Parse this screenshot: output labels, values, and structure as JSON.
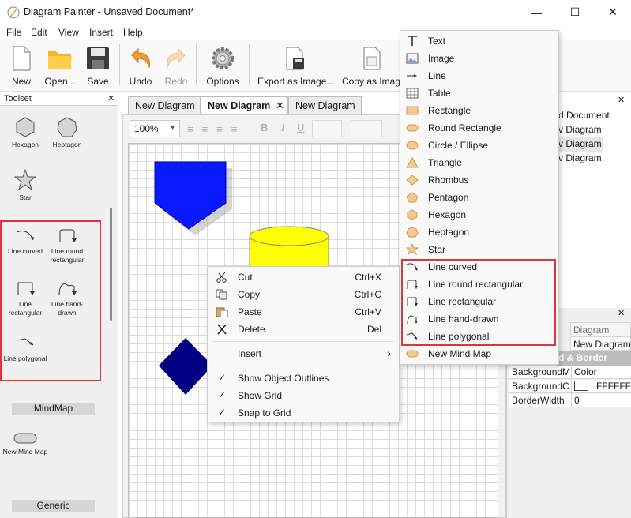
{
  "window": {
    "title": "Diagram Painter - Unsaved Document*",
    "minimize": "—",
    "maximize": "☐",
    "close": "✕"
  },
  "menu": [
    "File",
    "Edit",
    "View",
    "Insert",
    "Help"
  ],
  "toolbar": [
    {
      "label": "New",
      "icon": "new-document-icon"
    },
    {
      "label": "Open...",
      "icon": "open-folder-icon"
    },
    {
      "label": "Save",
      "icon": "save-disk-icon"
    },
    {
      "label": "Undo",
      "icon": "undo-arrow-icon"
    },
    {
      "label": "Redo",
      "icon": "redo-arrow-icon"
    },
    {
      "label": "Options",
      "icon": "gear-icon"
    },
    {
      "label": "Export as Image...",
      "icon": "export-image-icon"
    },
    {
      "label": "Copy as Imag",
      "icon": "copy-image-icon"
    }
  ],
  "toolset": {
    "title": "Toolset",
    "close": "✕",
    "items": [
      {
        "label": "Hexagon"
      },
      {
        "label": "Heptagon"
      },
      {
        "label": "Star"
      },
      {
        "label": "Line curved"
      },
      {
        "label": "Line round rectangular"
      },
      {
        "label": "Line rectangular"
      },
      {
        "label": "Line hand-drawn"
      },
      {
        "label": "Line polygonal"
      },
      {
        "label": "New Mind Map"
      }
    ],
    "sections": [
      "MindMap",
      "Generic"
    ]
  },
  "tabs": [
    {
      "label": "New Diagram",
      "active": false
    },
    {
      "label": "New Diagram",
      "active": true,
      "close": "✕"
    },
    {
      "label": "New Diagram",
      "active": false
    }
  ],
  "format_bar": {
    "zoom": "100%",
    "bold": "B",
    "italic": "I",
    "underline": "U"
  },
  "right_panel": {
    "tree": [
      "d Document",
      "v Diagram",
      "v Diagram",
      "v Diagram"
    ],
    "properties": {
      "header_value": "Diagram",
      "row_name_value": "New Diagram",
      "section": "d & Border",
      "rows": [
        {
          "name": "BackgroundM",
          "value": "Color"
        },
        {
          "name": "BackgroundC",
          "value": "FFFFFF"
        },
        {
          "name": "BorderWidth",
          "value": "0"
        }
      ]
    }
  },
  "context_menu": {
    "items": [
      {
        "label": "Cut",
        "shortcut": "Ctrl+X"
      },
      {
        "label": "Copy",
        "shortcut": "Ctrl+C"
      },
      {
        "label": "Paste",
        "shortcut": "Ctrl+V"
      },
      {
        "label": "Delete",
        "shortcut": "Del"
      },
      {
        "label": "Insert",
        "arrow": "›"
      },
      {
        "label": "Show Object Outlines",
        "check": "✓"
      },
      {
        "label": "Show Grid",
        "check": "✓"
      },
      {
        "label": "Snap to Grid",
        "check": "✓"
      }
    ]
  },
  "insert_submenu": [
    "Text",
    "Image",
    "Line",
    "Table",
    "Rectangle",
    "Round Rectangle",
    "Circle / Ellipse",
    "Triangle",
    "Rhombus",
    "Pentagon",
    "Hexagon",
    "Heptagon",
    "Star",
    "Line curved",
    "Line round rectangular",
    "Line rectangular",
    "Line hand-drawn",
    "Line polygonal",
    "New Mind Map"
  ],
  "colors": {
    "highlight": "#e0343d",
    "shape_blue": "#0a1aff",
    "shape_navy": "#000080",
    "shape_yellow": "#ffff00",
    "icon_tan": "#f4c98e"
  }
}
